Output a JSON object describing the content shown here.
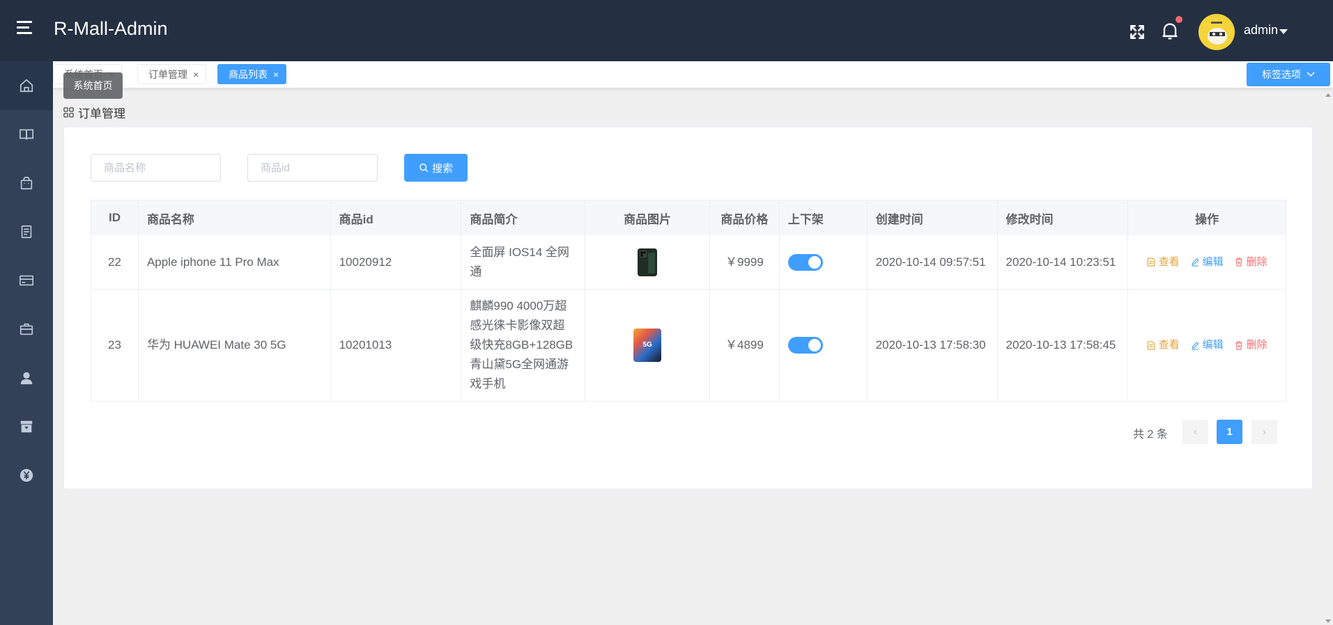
{
  "header": {
    "title": "R-Mall-Admin",
    "user": "admin",
    "icons": [
      "menu-toggle-icon",
      "fullscreen-icon",
      "bell-icon",
      "avatar",
      "caret-down-icon"
    ]
  },
  "sidebar": {
    "items": [
      {
        "icon": "home-icon",
        "active": true
      },
      {
        "icon": "book-icon",
        "active": false
      },
      {
        "icon": "shopping-bag-icon",
        "active": false
      },
      {
        "icon": "document-icon",
        "active": false
      },
      {
        "icon": "card-icon",
        "active": false
      },
      {
        "icon": "briefcase-icon",
        "active": false
      },
      {
        "icon": "user-icon",
        "active": false
      },
      {
        "icon": "archive-icon",
        "active": false
      },
      {
        "icon": "yen-icon",
        "active": false
      }
    ],
    "tooltip": "系统首页"
  },
  "tags": {
    "items": [
      {
        "label": "系统首页",
        "close": "×"
      },
      {
        "label": "订单管理",
        "close": "×"
      },
      {
        "label": "商品列表",
        "close": "×",
        "active": true
      }
    ],
    "options_label": "标签选项"
  },
  "breadcrumb": {
    "label": "订单管理"
  },
  "search": {
    "name_placeholder": "商品名称",
    "id_placeholder": "商品id",
    "button_label": "搜索"
  },
  "table": {
    "columns": [
      "ID",
      "商品名称",
      "商品id",
      "商品简介",
      "商品图片",
      "商品价格",
      "上下架",
      "创建时间",
      "修改时间",
      "操作"
    ],
    "rows": [
      {
        "id": "22",
        "name": "Apple iphone 11 Pro Max",
        "pid": "10020912",
        "desc": "全面屏 IOS14 全网通",
        "price": "￥9999",
        "on_shelf": true,
        "created": "2020-10-14 09:57:51",
        "modified": "2020-10-14 10:23:51"
      },
      {
        "id": "23",
        "name": "华为 HUAWEI Mate 30 5G",
        "pid": "10201013",
        "desc": "麒麟990 4000万超感光徕卡影像双超级快充8GB+128GB青山黛5G全网通游戏手机",
        "image_text": "5G",
        "price": "￥4899",
        "on_shelf": true,
        "created": "2020-10-13 17:58:30",
        "modified": "2020-10-13 17:58:45"
      }
    ],
    "actions": {
      "view": "查看",
      "edit": "编辑",
      "delete": "删除"
    }
  },
  "pagination": {
    "total_label": "共 2 条",
    "current_page": "1",
    "prev": "‹",
    "next": "›"
  },
  "colors": {
    "header_bg": "#242f42",
    "sidebar_bg": "#324157",
    "primary": "#409eff",
    "warning": "#e6a23c",
    "danger": "#f56c6c"
  }
}
